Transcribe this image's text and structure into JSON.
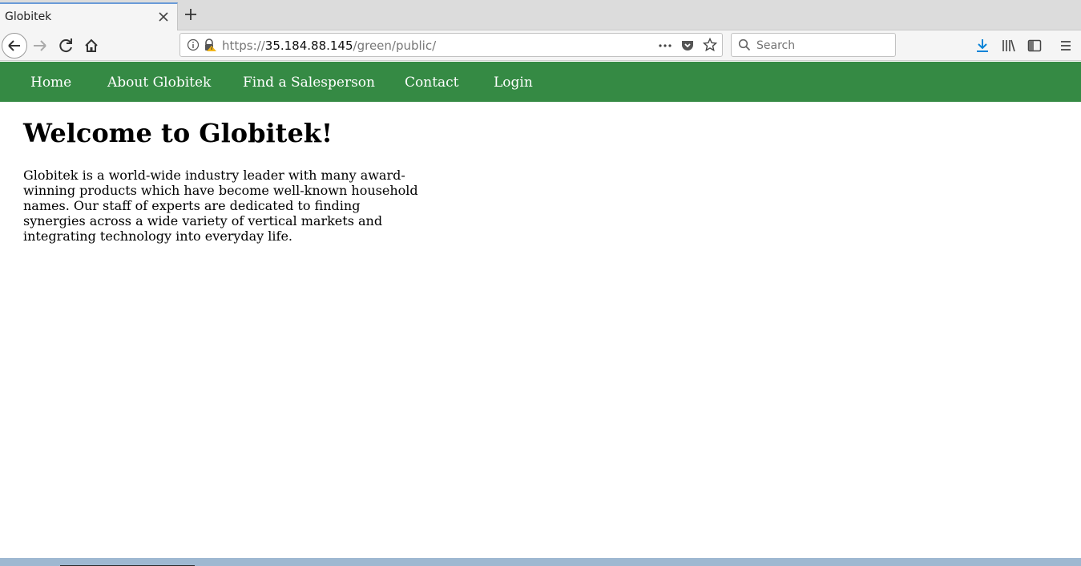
{
  "browser": {
    "tab_title": "Globitek",
    "url_scheme": "https://",
    "url_host": "35.184.88.145",
    "url_path": "/green/public/",
    "search_placeholder": "Search"
  },
  "site": {
    "nav_color": "#358a44",
    "nav": [
      {
        "label": "Home"
      },
      {
        "label": "About Globitek"
      },
      {
        "label": "Find a Salesperson"
      },
      {
        "label": "Contact"
      },
      {
        "label": "Login"
      }
    ],
    "heading": "Welcome to Globitek!",
    "intro": "Globitek is a world-wide industry leader with many award-winning products which have become well-known household names. Our staff of experts are dedicated to finding synergies across a wide variety of vertical markets and integrating technology into everyday life."
  }
}
